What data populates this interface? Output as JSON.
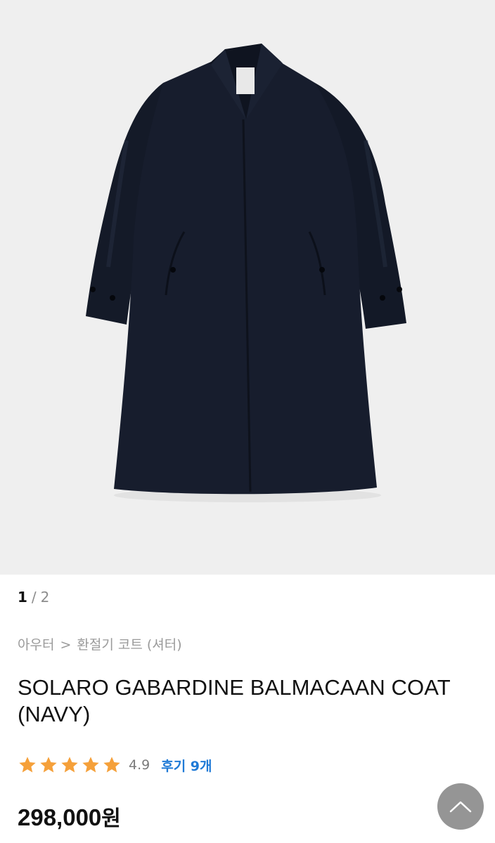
{
  "gallery": {
    "current": "1",
    "separator": "/",
    "total": "2",
    "image_alt": "navy balmacaan coat product photo"
  },
  "breadcrumb": {
    "category": "아우터",
    "arrow": ">",
    "subcategory": "환절기 코트 (셔터)"
  },
  "product": {
    "title": "SOLARO GABARDINE BALMACAAN COAT (NAVY)",
    "rating_value": 4.9,
    "rating_text": "4.9",
    "stars": 5,
    "reviews_label": "후기 9개",
    "price": "298,000",
    "price_unit": "원"
  },
  "icons": {
    "star": "star-icon",
    "scroll_top": "chevron-up-icon"
  },
  "colors": {
    "star": "#f5a03a",
    "review_link": "#1f7ad6",
    "gallery_bg": "#efefef",
    "coat": "#161c2b",
    "scroll_top_bg": "#8a8a8a"
  }
}
